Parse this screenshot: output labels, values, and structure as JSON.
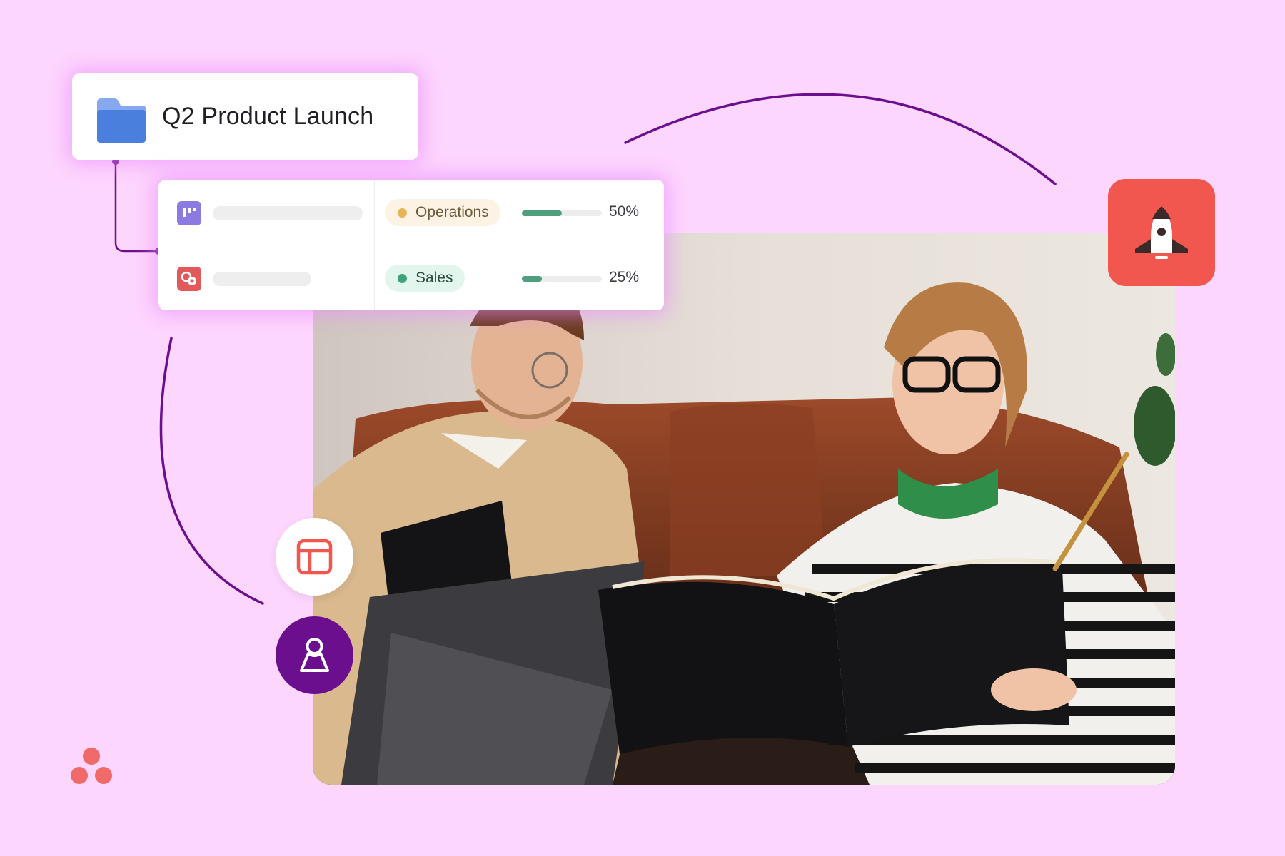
{
  "project": {
    "title": "Q2 Product Launch",
    "icon": "folder-icon"
  },
  "tasks": [
    {
      "app_icon": "board-app-icon",
      "tag": "Operations",
      "progress_percent": 50,
      "progress_label": "50%"
    },
    {
      "app_icon": "integration-app-icon",
      "tag": "Sales",
      "progress_percent": 25,
      "progress_label": "25%"
    }
  ],
  "icons": {
    "rocket": "rocket-icon",
    "layout": "layout-icon",
    "user": "user-icon",
    "brand": "brand-logo-dots"
  },
  "colors": {
    "background": "#fdd6fd",
    "accent_purple": "#6b0f8f",
    "rocket_tile": "#f2574f",
    "folder_blue": "#4a7fde",
    "operations_dot": "#e6b454",
    "sales_dot": "#3ea37a",
    "progress_fill": "#4f9f7e",
    "brand_coral": "#f06a6a"
  }
}
